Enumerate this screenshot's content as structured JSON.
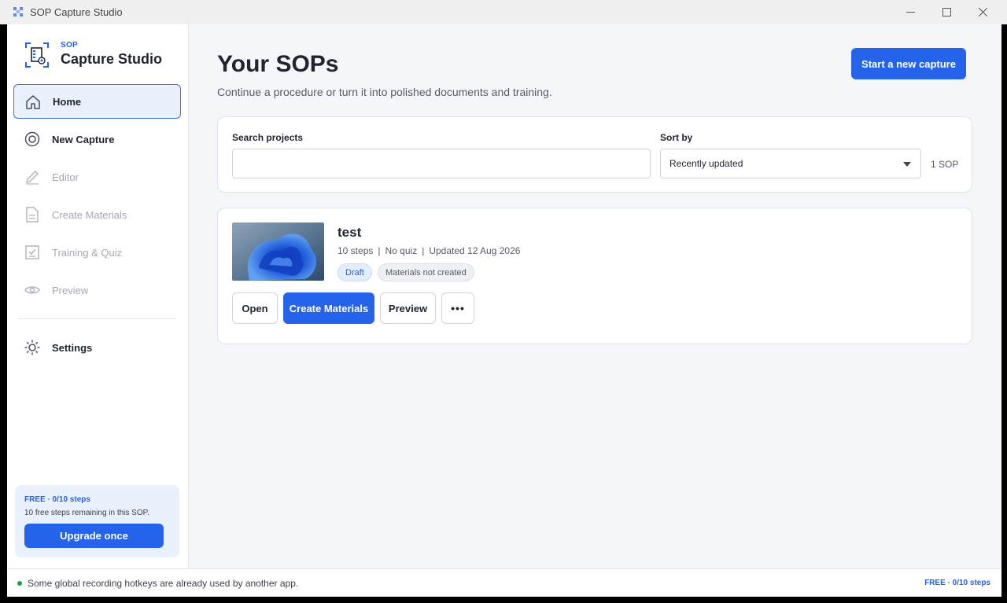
{
  "window": {
    "title": "SOP Capture Studio"
  },
  "brand": {
    "super": "SOP",
    "name": "Capture Studio"
  },
  "sidebar": {
    "items": [
      {
        "label": "Home",
        "icon": "home-icon",
        "state": "active"
      },
      {
        "label": "New Capture",
        "icon": "record-icon",
        "state": "enabled"
      },
      {
        "label": "Editor",
        "icon": "pencil-icon",
        "state": "disabled"
      },
      {
        "label": "Create Materials",
        "icon": "document-icon",
        "state": "disabled"
      },
      {
        "label": "Training & Quiz",
        "icon": "checklist-icon",
        "state": "disabled"
      },
      {
        "label": "Preview",
        "icon": "eye-icon",
        "state": "disabled"
      },
      {
        "label": "Settings",
        "icon": "gear-icon",
        "state": "enabled"
      }
    ],
    "plan": {
      "title": "FREE · 0/10 steps",
      "description": "10 free steps remaining in this SOP.",
      "upgrade_label": "Upgrade once"
    }
  },
  "main": {
    "title": "Your SOPs",
    "subtitle": "Continue a procedure or turn it into polished documents and training.",
    "new_capture_label": "Start a new capture",
    "filters": {
      "search_label": "Search projects",
      "search_value": "",
      "sort_label": "Sort by",
      "sort_value": "Recently updated",
      "count": "1 SOP"
    },
    "projects": [
      {
        "title": "test",
        "steps": "10 steps",
        "quiz": "No quiz",
        "updated": "Updated 12 Aug 2026",
        "badges": [
          "Draft",
          "Materials not created"
        ],
        "actions": {
          "open": "Open",
          "create": "Create Materials",
          "preview": "Preview",
          "more": "•••"
        }
      }
    ]
  },
  "statusbar": {
    "message": "Some global recording hotkeys are already used by another app.",
    "plan": "FREE · 0/10 steps"
  },
  "colors": {
    "accent": "#2563eb",
    "active_nav_bg": "#e9f1fd",
    "background": "#f4f6fa",
    "status_ok": "#1e9e4a"
  }
}
